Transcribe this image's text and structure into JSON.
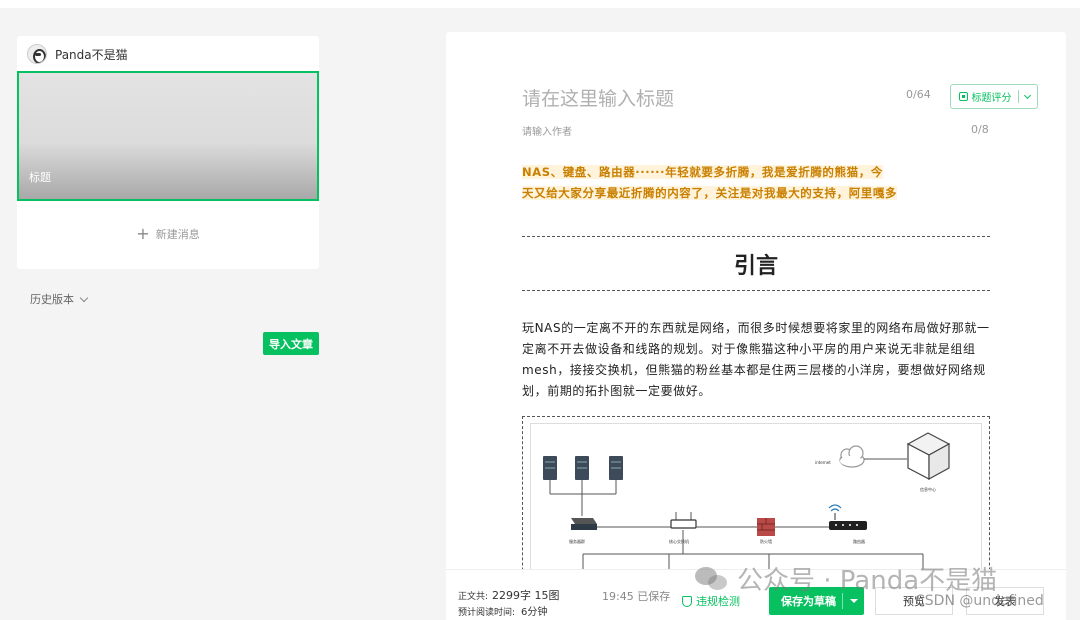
{
  "account": {
    "name": "Panda不是猫"
  },
  "article_card": {
    "cover_title": "标题",
    "new_message_label": "新建消息"
  },
  "history": {
    "label": "历史版本"
  },
  "import_button": "导入文章",
  "editor": {
    "title_placeholder": "请在这里输入标题",
    "title_count": "0/64",
    "score_button": "标题评分",
    "author_placeholder": "请输入作者",
    "author_count": "0/8",
    "intro_line1": "NAS、键盘、路由器······年轻就要多折腾，我是爱折腾的熊猫，今",
    "intro_line2": "天又给大家分享最近折腾的内容了，关注是对我最大的支持，阿里嘎多",
    "heading": "引言",
    "body": "玩NAS的一定离不开的东西就是网络，而很多时候想要将家里的网络布局做好那就一定离不开去做设备和线路的规划。对于像熊猫这种小平房的用户来说无非就是组组mesh，接接交换机，但熊猫的粉丝基本都是住两三层楼的小洋房，要想做好网络规划，前期的拓扑图就一定要做好。",
    "diagram_labels": {
      "internet": "internet",
      "data_center": "信息中心",
      "servers": "服务器群",
      "core_switch": "核心交换机",
      "firewall": "防火墙",
      "router": "路由器"
    }
  },
  "bottom_bar": {
    "word_count_label": "正文共:",
    "word_count_value": "2299字 15图",
    "read_time_label": "预计阅读时间:",
    "read_time_value": "6分钟",
    "saved_status": "19:45  已保存",
    "check_label": "违规检测",
    "save_draft": "保存为草稿",
    "preview": "预览",
    "publish": "发表"
  },
  "watermark": {
    "text": "公众号 · Panda不是猫",
    "csdn": "CSDN @undefined"
  },
  "colors": {
    "accent": "#07c160",
    "intro_text": "#c98000",
    "intro_highlight": "#fff3dc"
  }
}
